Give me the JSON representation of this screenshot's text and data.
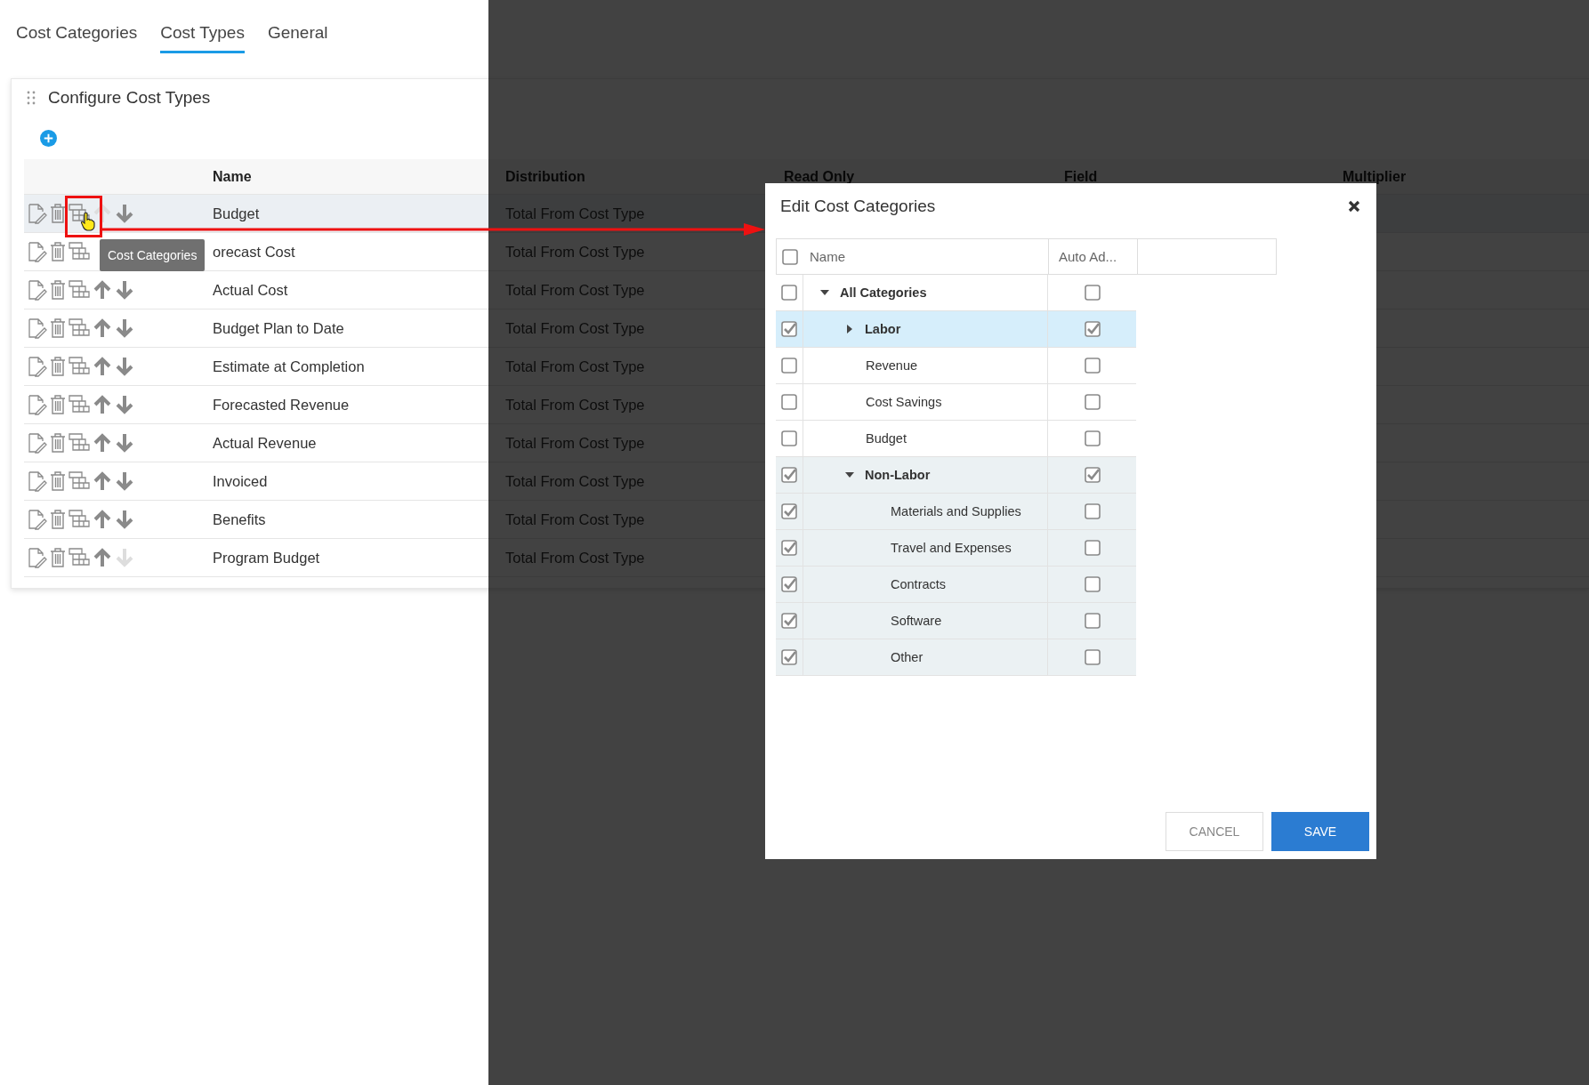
{
  "tabs": [
    {
      "label": "Cost Categories",
      "selected": false
    },
    {
      "label": "Cost Types",
      "selected": true
    },
    {
      "label": "General",
      "selected": false
    }
  ],
  "panel": {
    "title": "Configure Cost Types"
  },
  "table": {
    "columns": [
      "Name",
      "Distribution",
      "Read Only",
      "Field",
      "Multiplier"
    ],
    "rows": [
      {
        "name": "Budget",
        "distribution": "Total From Cost Type",
        "selected": true,
        "up_disabled": true,
        "down_disabled": false
      },
      {
        "name": "orecast Cost",
        "distribution": "Total From Cost Type",
        "selected": false
      },
      {
        "name": "Actual Cost",
        "distribution": "Total From Cost Type",
        "selected": false,
        "up_disabled": false,
        "down_disabled": false
      },
      {
        "name": "Budget Plan to Date",
        "distribution": "Total From Cost Type",
        "selected": false,
        "up_disabled": false,
        "down_disabled": false
      },
      {
        "name": "Estimate at Completion",
        "distribution": "Total From Cost Type",
        "selected": false,
        "up_disabled": false,
        "down_disabled": false
      },
      {
        "name": "Forecasted Revenue",
        "distribution": "Total From Cost Type",
        "selected": false,
        "up_disabled": false,
        "down_disabled": false
      },
      {
        "name": "Actual Revenue",
        "distribution": "Total From Cost Type",
        "selected": false,
        "up_disabled": false,
        "down_disabled": false
      },
      {
        "name": "Invoiced",
        "distribution": "Total From Cost Type",
        "selected": false,
        "up_disabled": false,
        "down_disabled": false
      },
      {
        "name": "Benefits",
        "distribution": "Total From Cost Type",
        "selected": false,
        "up_disabled": false,
        "down_disabled": false
      },
      {
        "name": "Program Budget",
        "distribution": "Total From Cost Type",
        "selected": false,
        "up_disabled": false,
        "down_disabled": true
      }
    ]
  },
  "tooltip": {
    "text": "Cost Categories"
  },
  "modal": {
    "title": "Edit Cost Categories",
    "select_all_checked": false,
    "columns": [
      "Name",
      "Auto Ad..."
    ],
    "tree": [
      {
        "name": "All Categories",
        "checked": false,
        "auto_add": false,
        "selected": false,
        "expanded": true,
        "children": [
          {
            "name": "Labor",
            "checked": true,
            "auto_add": true,
            "selected": true,
            "expanded": false
          },
          {
            "name": "Revenue",
            "checked": false,
            "auto_add": false,
            "selected": false
          },
          {
            "name": "Cost Savings",
            "checked": false,
            "auto_add": false,
            "selected": false
          },
          {
            "name": "Budget",
            "checked": false,
            "auto_add": false,
            "selected": false
          },
          {
            "name": "Non-Labor",
            "checked": true,
            "auto_add": true,
            "selected": false,
            "expanded": true,
            "children": [
              {
                "name": "Materials and Supplies",
                "checked": true,
                "auto_add": false,
                "selected": false
              },
              {
                "name": "Travel and Expenses",
                "checked": true,
                "auto_add": false,
                "selected": false
              },
              {
                "name": "Contracts",
                "checked": true,
                "auto_add": false,
                "selected": false
              },
              {
                "name": "Software",
                "checked": true,
                "auto_add": false,
                "selected": false
              },
              {
                "name": "Other",
                "checked": true,
                "auto_add": false,
                "selected": false
              }
            ]
          }
        ]
      }
    ],
    "buttons": [
      {
        "label": "CANCEL",
        "kind": "secondary"
      },
      {
        "label": "SAVE",
        "kind": "primary"
      }
    ]
  }
}
